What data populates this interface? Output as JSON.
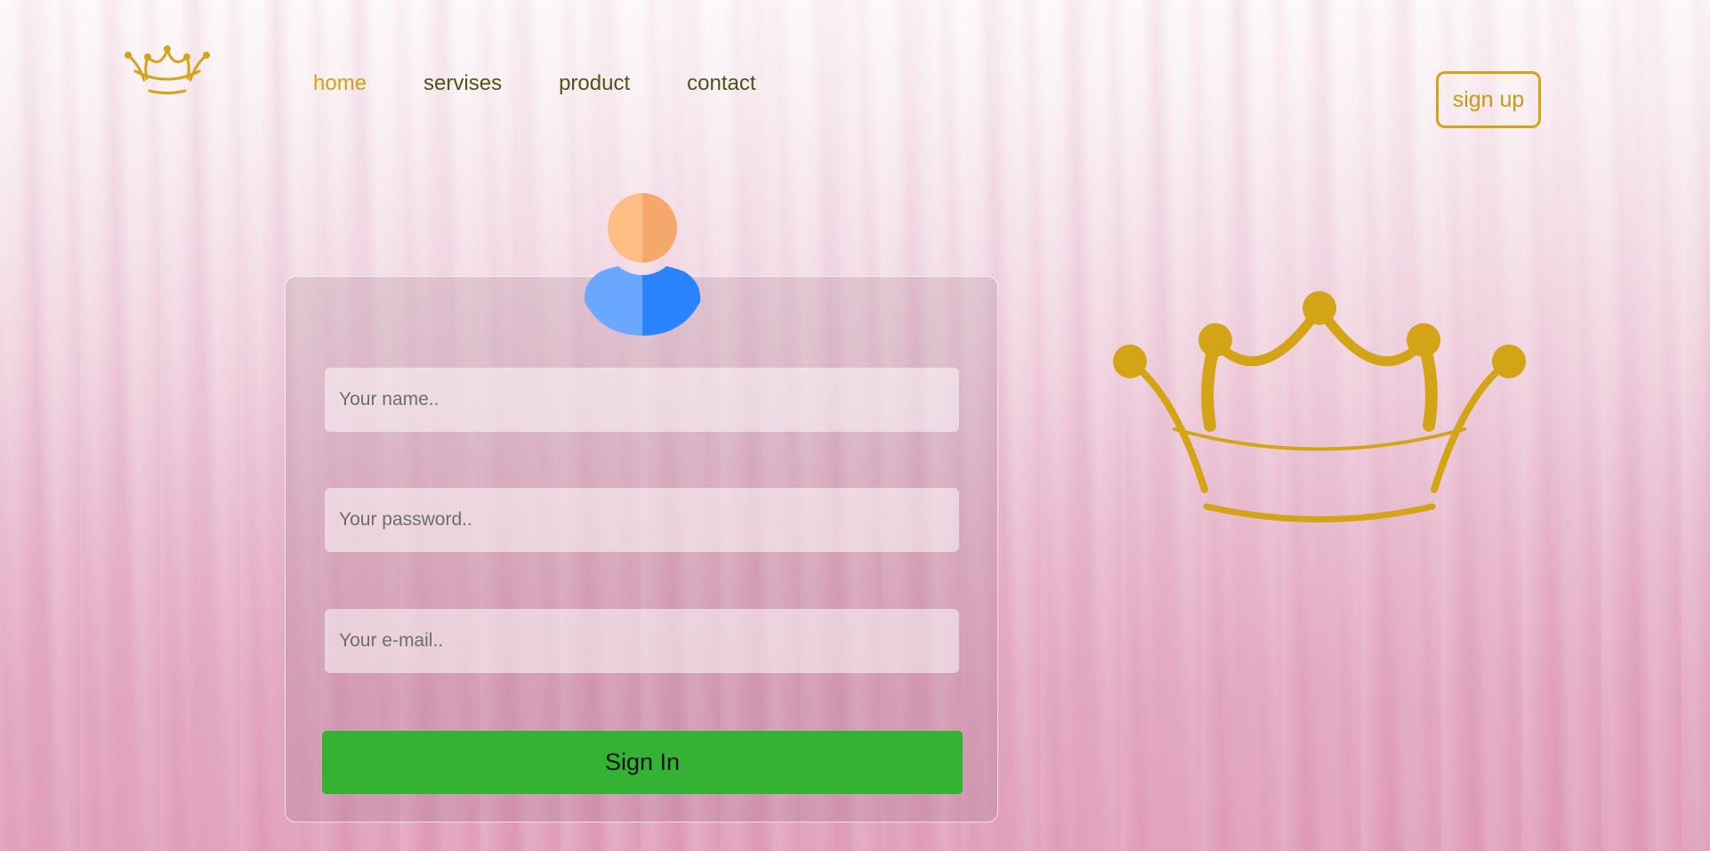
{
  "header": {
    "logo_icon": "crown-icon",
    "nav": [
      {
        "label": "home",
        "active": true
      },
      {
        "label": "servises",
        "active": false
      },
      {
        "label": "product",
        "active": false
      },
      {
        "label": "contact",
        "active": false
      }
    ],
    "signup_label": "sign up"
  },
  "form": {
    "avatar_icon": "user-avatar-icon",
    "fields": {
      "name": {
        "placeholder": "Your name..",
        "value": ""
      },
      "password": {
        "placeholder": "Your password..",
        "value": ""
      },
      "email": {
        "placeholder": "Your e-mail..",
        "value": ""
      }
    },
    "submit_label": "Sign In"
  },
  "hero": {
    "illustration_icon": "crown-icon"
  },
  "colors": {
    "gold": "#d4a417",
    "nav_active": "#d2a20f",
    "nav_text": "#4f5517",
    "submit_green": "#33b234",
    "avatar_skin_light": "#ffbd86",
    "avatar_skin_dark": "#f4a86c",
    "avatar_body_light": "#6aa7ff",
    "avatar_body_dark": "#2a84ff"
  }
}
